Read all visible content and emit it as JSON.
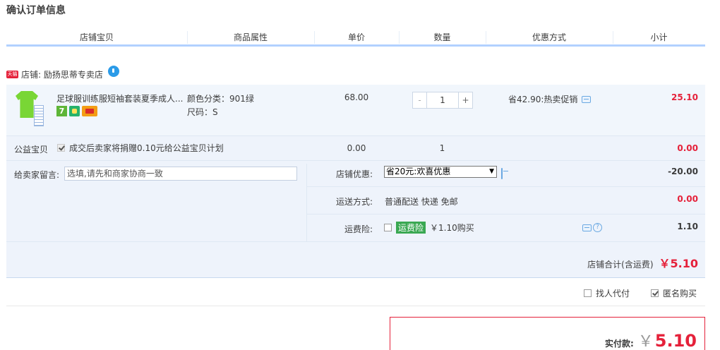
{
  "page": {
    "title": "确认订单信息"
  },
  "columns": [
    "店铺宝贝",
    "商品属性",
    "单价",
    "数量",
    "优惠方式",
    "小计"
  ],
  "store": {
    "badge": "天猫",
    "label": "店铺: 励扬思蒂专卖店"
  },
  "item": {
    "title": "足球服训练服短袖套装夏季成人...",
    "attr_color": "颜色分类：901绿",
    "attr_size": "尺码：S",
    "price": "68.00",
    "qty_minus": "-",
    "qty": "1",
    "qty_plus": "+",
    "promo": "省42.90:热卖促销",
    "subtotal": "25.10",
    "badge_7": "7"
  },
  "charity": {
    "label": "公益宝贝",
    "desc": "成交后卖家将捐赠0.10元给公益宝贝计划",
    "price": "0.00",
    "qty": "1",
    "subtotal": "0.00"
  },
  "message": {
    "label": "给卖家留言:",
    "placeholder": "选填,请先和商家协商一致"
  },
  "store_discount": {
    "label": "店铺优惠:",
    "selected": "省20元:欢喜优惠",
    "value": "-20.00"
  },
  "shipping": {
    "label": "运送方式:",
    "method": "普通配送 快递 免邮",
    "value": "0.00"
  },
  "insurance": {
    "label": "运费险:",
    "tag": "运费险",
    "price": "￥1.10购买",
    "value": "1.10",
    "help": "?"
  },
  "store_total": {
    "label": "店铺合计(含运费)",
    "amount": "￥5.10"
  },
  "options": {
    "proxy": "找人代付",
    "anonymous": "匿名购买"
  },
  "payment": {
    "label": "实付款:",
    "yen": "￥",
    "amount": "5.10"
  },
  "colors": {
    "accent": "#e5213a",
    "header_line": "#b2d1ff",
    "panel": "#eef3fb"
  }
}
